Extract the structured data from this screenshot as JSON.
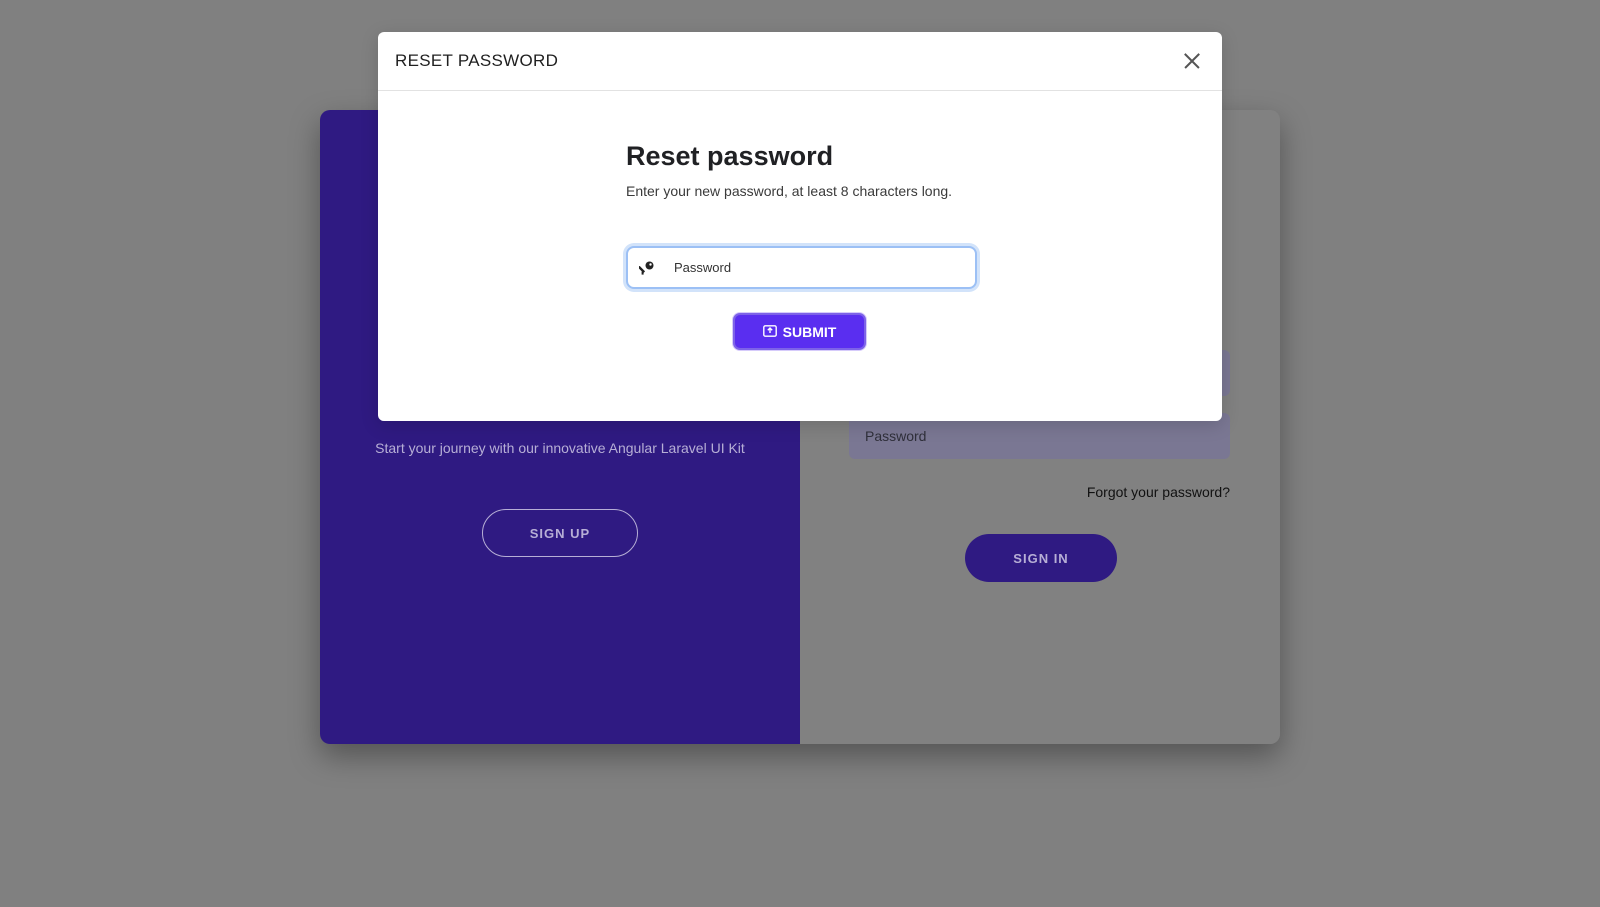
{
  "background_card": {
    "left_panel": {
      "lead_text": "Start your journey with our innovative Angular Laravel UI Kit",
      "signup_label": "SIGN UP"
    },
    "right_panel": {
      "email_placeholder": "",
      "password_placeholder": "Password",
      "forgot_label": "Forgot your password?",
      "signin_label": "SIGN IN"
    }
  },
  "modal": {
    "title": "RESET PASSWORD",
    "heading": "Reset password",
    "description": "Enter your new password, at least 8 characters long.",
    "password_placeholder": "Password",
    "submit_label": "SUBMIT",
    "close_icon": "close-icon",
    "key_icon": "key-icon",
    "submit_icon": "submit-icon"
  },
  "colors": {
    "overlay": "#808080",
    "left_panel": "#2f1a82",
    "submit_button": "#5a2ef0",
    "input_focus": "#9cc0f5"
  }
}
